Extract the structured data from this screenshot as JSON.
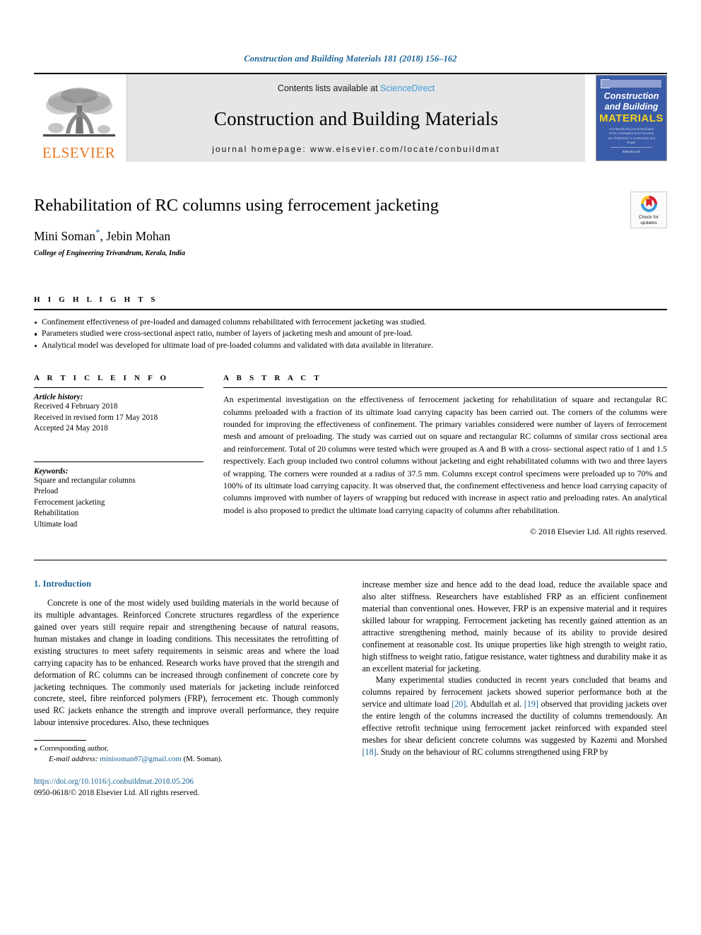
{
  "running_head": "Construction and Building Materials 181 (2018) 156–162",
  "masthead": {
    "publisher_name": "ELSEVIER",
    "contents_prefix": "Contents lists available at ",
    "contents_link": "ScienceDirect",
    "journal_title": "Construction and Building Materials",
    "homepage": "journal homepage: www.elsevier.com/locate/conbuildmat",
    "cover": {
      "line1": "Construction",
      "line2": "and Building",
      "line3": "MATERIALS",
      "blurb": "An international journal Dedicated to the Investigation and Innovative use of Materials in Construction and Repair",
      "footer": "Elsevier.com"
    }
  },
  "article": {
    "title": "Rehabilitation of RC columns using ferrocement jacketing",
    "authors": "Mini Soman",
    "author_star": "*",
    "authors_rest": ", Jebin Mohan",
    "affiliation": "College of Engineering Trivandrum, Kerala, India",
    "crossmark": {
      "line1": "Check for",
      "line2": "updates"
    }
  },
  "highlights": {
    "heading": "H I G H L I G H T S",
    "items": [
      "Confinement effectiveness of pre-loaded and damaged columns rehabilitated with ferrocement jacketing was studied.",
      "Parameters studied were cross-sectional aspect ratio, number of layers of jacketing mesh and amount of pre-load.",
      "Analytical model was developed for ultimate load of pre-loaded columns and validated with data available in literature."
    ]
  },
  "article_info": {
    "heading": "A R T I C L E   I N F O",
    "history_label": "Article history:",
    "history": [
      "Received 4 February 2018",
      "Received in revised form 17 May 2018",
      "Accepted 24 May 2018"
    ],
    "keywords_label": "Keywords:",
    "keywords": [
      "Square and rectangular columns",
      "Preload",
      "Ferrocement jacketing",
      "Rehabilitation",
      "Ultimate load"
    ]
  },
  "abstract": {
    "heading": "A B S T R A C T",
    "text": "An experimental investigation on the effectiveness of ferrocement jacketing for rehabilitation of square and rectangular RC columns preloaded with a fraction of its ultimate load carrying capacity has been carried out. The corners of the columns were rounded for improving the effectiveness of confinement. The primary variables considered were number of layers of ferrocement mesh and amount of preloading. The study was carried out on square and rectangular RC columns of similar cross sectional area and reinforcement. Total of 20 columns were tested which were grouped as A and B with a cross- sectional aspect ratio of 1 and 1.5 respectively. Each group included two control columns without jacketing and eight rehabilitated columns with two and three layers of wrapping. The corners were rounded at a radius of 37.5 mm. Columns except control specimens were preloaded up to 70% and 100% of its ultimate load carrying capacity. It was observed that, the confinement effectiveness and hence load carrying capacity of columns improved with number of layers of wrapping but reduced with increase in aspect ratio and preloading rates. An analytical model is also proposed to predict the ultimate load carrying capacity of columns after rehabilitation.",
    "copyright": "© 2018 Elsevier Ltd. All rights reserved."
  },
  "body": {
    "section_title": "1. Introduction",
    "left_para1": "Concrete is one of the most widely used building materials in the world because of its multiple advantages. Reinforced Concrete structures regardless of the experience gained over years still require repair and strengthening because of natural reasons, human mistakes and change in loading conditions. This necessitates the retrofitting of existing structures to meet safety requirements in seismic areas and where the load carrying capacity has to be enhanced. Research works have proved that the strength and deformation of RC columns can be increased through confinement of concrete core by jacketing techniques. The commonly used materials for jacketing include reinforced concrete, steel, fibre reinforced polymers (FRP), ferrocement etc. Though commonly used RC jackets enhance the strength and improve overall performance, they require labour intensive procedures. Also, these techniques",
    "right_para1": "increase member size and hence add to the dead load, reduce the available space and also alter stiffness. Researchers have established FRP as an efficient confinement material than conventional ones. However, FRP is an expensive material and it requires skilled labour for wrapping. Ferrocement jacketing has recently gained attention as an attractive strengthening method, mainly because of its ability to provide desired confinement at reasonable cost. Its unique properties like high strength to weight ratio, high stiffness to weight ratio, fatigue resistance, water tightness and durability make it as an excellent material for jacketing.",
    "right_para2_a": "Many experimental studies conducted in recent years concluded that beams and columns repaired by ferrocement jackets showed superior performance both at the service and ultimate load ",
    "right_ref1": "[20]",
    "right_para2_b": ". Abdullah et al. ",
    "right_ref2": "[19]",
    "right_para2_c": " observed that providing jackets over the entire length of the columns increased the ductility of columns tremendously. An effective retrofit technique using ferrocement jacket reinforced with expanded steel meshes for shear deficient concrete columns was suggested by Kazemi and Morshed ",
    "right_ref3": "[18]",
    "right_para2_d": ". Study on the behaviour of RC columns strengthened using FRP by"
  },
  "footnotes": {
    "corresponding": "Corresponding author.",
    "corresponding_star": "⁎",
    "email_label": "E-mail address:",
    "email": "minisoman87@gmail.com",
    "email_suffix": " (M. Soman).",
    "doi": "https://doi.org/10.1016/j.conbuildmat.2018.05.206",
    "issn": "0950-0618/© 2018 Elsevier Ltd. All rights reserved."
  },
  "colors": {
    "link_blue": "#1a6496",
    "sciencedirect_blue": "#3a9ad9",
    "elsevier_orange": "#e87722",
    "cover_blue": "#3a5ba8",
    "cover_yellow": "#f4d21e"
  }
}
